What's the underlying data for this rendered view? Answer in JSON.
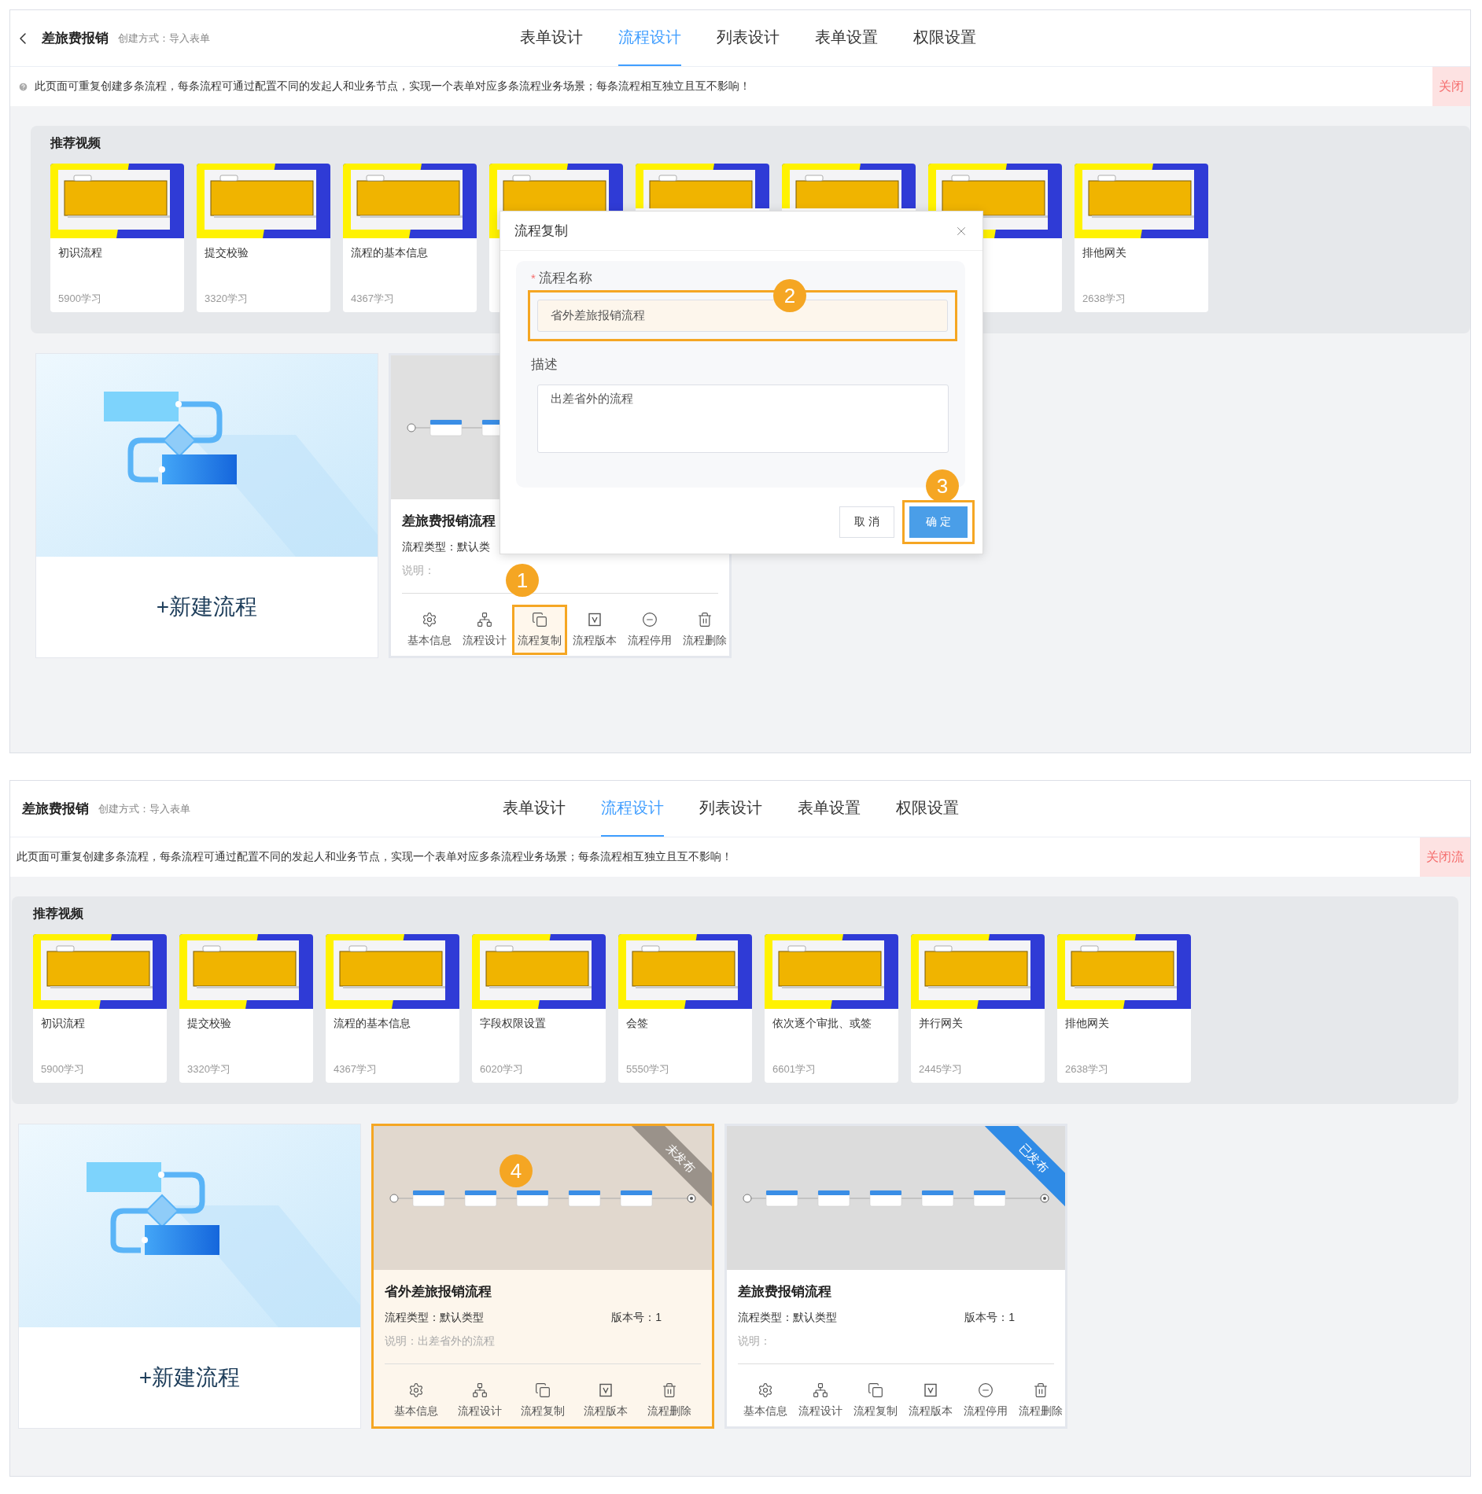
{
  "panels": [
    {
      "header": {
        "back_arrow": true,
        "title": "差旅费报销",
        "subtitle": "创建方式：导入表单",
        "tabs": [
          {
            "label": "表单设计",
            "selected": false
          },
          {
            "label": "流程设计",
            "selected": true
          },
          {
            "label": "列表设计",
            "selected": false
          },
          {
            "label": "表单设置",
            "selected": false
          },
          {
            "label": "权限设置",
            "selected": false
          }
        ]
      },
      "notice": {
        "text": "此页面可重复创建多条流程，每条流程可通过配置不同的发起人和业务节点，实现一个表单对应多条流程业务场景；每条流程相互独立且互不影响！",
        "close_label": "关闭"
      },
      "videos": {
        "title": "推荐视频",
        "items": [
          {
            "title": "初识流程",
            "count": "5900学习"
          },
          {
            "title": "提交校验",
            "count": "3320学习"
          },
          {
            "title": "流程的基本信息",
            "count": "4367学习"
          },
          {
            "kind": "picture"
          },
          {
            "kind": "picture_top"
          },
          {
            "kind": "picture_top"
          },
          {
            "kind": "picture"
          },
          {
            "title": "排他网关",
            "count": "2638学习"
          }
        ]
      },
      "new_flow": {
        "label": "+新建流程"
      },
      "flows": [
        {
          "name": "差旅费报销流程",
          "type": "流程类型：默认类",
          "description": "说明：",
          "highlighted": false,
          "actions": [
            {
              "label": "基本信息",
              "kind": "settings",
              "highlighted": false
            },
            {
              "label": "流程设计",
              "kind": "design",
              "highlighted": false
            },
            {
              "label": "流程复制",
              "kind": "copy",
              "highlighted": true,
              "annotation": "1"
            },
            {
              "label": "流程版本",
              "kind": "version",
              "highlighted": false
            },
            {
              "label": "流程停用",
              "kind": "disable",
              "highlighted": false
            },
            {
              "label": "流程删除",
              "kind": "delete",
              "highlighted": false
            }
          ]
        }
      ],
      "dialog": {
        "title": "流程复制",
        "name_label": "流程名称",
        "required_mark": "*",
        "name_value": "省外差旅报销流程",
        "name_highlighted": true,
        "name_annotation": "2",
        "description_label": "描述",
        "description_value": "出差省外的流程",
        "cancel": "取 消",
        "confirm": "确 定",
        "confirm_highlighted": true,
        "confirm_annotation": "3"
      }
    },
    {
      "header": {
        "back_arrow": false,
        "title": "差旅费报销",
        "subtitle": "创建方式：导入表单",
        "tabs": [
          {
            "label": "表单设计",
            "selected": false
          },
          {
            "label": "流程设计",
            "selected": true
          },
          {
            "label": "列表设计",
            "selected": false
          },
          {
            "label": "表单设置",
            "selected": false
          },
          {
            "label": "权限设置",
            "selected": false
          }
        ]
      },
      "notice": {
        "text": "此页面可重复创建多条流程，每条流程可通过配置不同的发起人和业务节点，实现一个表单对应多条流程业务场景；每条流程相互独立且互不影响！",
        "close_label": "关闭流"
      },
      "videos": {
        "title": "推荐视频",
        "items": [
          {
            "title": "初识流程",
            "count": "5900学习"
          },
          {
            "title": "提交校验",
            "count": "3320学习"
          },
          {
            "title": "流程的基本信息",
            "count": "4367学习"
          },
          {
            "title": "字段权限设置",
            "count": "6020学习"
          },
          {
            "title": "会签",
            "count": "5550学习"
          },
          {
            "title": "依次逐个审批、或签",
            "count": "6601学习"
          },
          {
            "title": "并行网关",
            "count": "2445学习"
          },
          {
            "title": "排他网关",
            "count": "2638学习"
          }
        ]
      },
      "new_flow": {
        "label": "+新建流程"
      },
      "flows": [
        {
          "name": "省外差旅报销流程",
          "type": "流程类型：默认类型",
          "version": "版本号：1",
          "description": "说明：出差省外的流程",
          "highlighted": true,
          "annotation": "4",
          "published": false,
          "status_label": "未发布",
          "actions": [
            {
              "label": "基本信息",
              "kind": "settings",
              "highlighted": false
            },
            {
              "label": "流程设计",
              "kind": "design",
              "highlighted": false
            },
            {
              "label": "流程复制",
              "kind": "copy",
              "highlighted": false
            },
            {
              "label": "流程版本",
              "kind": "version",
              "highlighted": false
            },
            {
              "label": "流程删除",
              "kind": "delete",
              "highlighted": false
            }
          ]
        },
        {
          "name": "差旅费报销流程",
          "type": "流程类型：默认类型",
          "version": "版本号：1",
          "description": "说明：",
          "highlighted": false,
          "published": true,
          "status_label": "已发布",
          "actions": [
            {
              "label": "基本信息",
              "kind": "settings",
              "highlighted": false
            },
            {
              "label": "流程设计",
              "kind": "design",
              "highlighted": false
            },
            {
              "label": "流程复制",
              "kind": "copy",
              "highlighted": false
            },
            {
              "label": "流程版本",
              "kind": "version",
              "highlighted": false
            },
            {
              "label": "流程停用",
              "kind": "disable",
              "highlighted": false
            },
            {
              "label": "流程删除",
              "kind": "delete",
              "highlighted": false
            }
          ]
        }
      ]
    }
  ]
}
